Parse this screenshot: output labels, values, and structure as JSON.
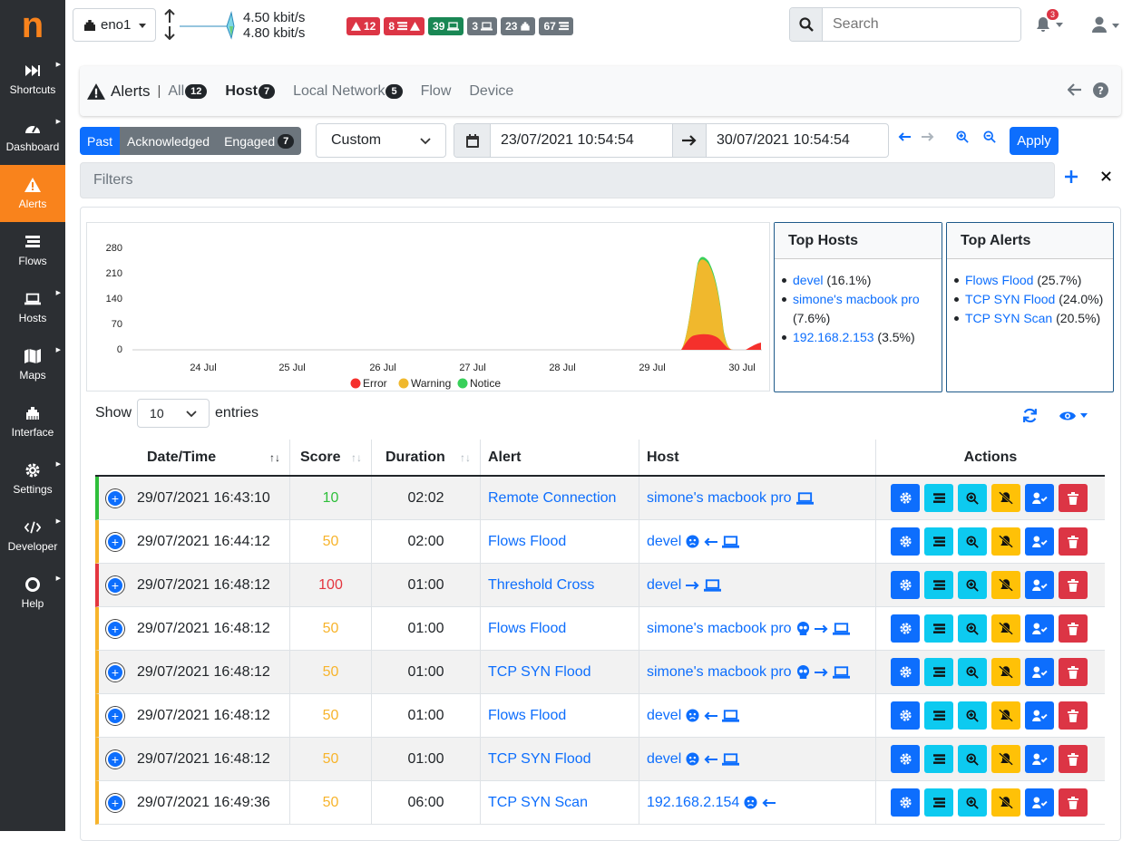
{
  "app": {
    "logo": "n"
  },
  "sidebar": {
    "items": [
      {
        "label": "Shortcuts",
        "icon": "fast-forward-icon"
      },
      {
        "label": "Dashboard",
        "icon": "gauge-icon"
      },
      {
        "label": "Alerts",
        "icon": "warning-icon",
        "active": true
      },
      {
        "label": "Flows",
        "icon": "stream-icon"
      },
      {
        "label": "Hosts",
        "icon": "laptop-icon"
      },
      {
        "label": "Maps",
        "icon": "map-icon"
      },
      {
        "label": "Interface",
        "icon": "ethernet-icon"
      },
      {
        "label": "Settings",
        "icon": "cog-icon"
      },
      {
        "label": "Developer",
        "icon": "code-icon"
      },
      {
        "label": "Help",
        "icon": "lifebuoy-icon"
      }
    ]
  },
  "topbar": {
    "interface": "eno1",
    "upload": "4.50 kbit/s",
    "download": "4.80 kbit/s",
    "search_placeholder": "Search",
    "notifications": "3",
    "badges": [
      {
        "value": "12",
        "color": "red"
      },
      {
        "value": "8",
        "color": "red"
      },
      {
        "value": "39",
        "color": "green"
      },
      {
        "value": "3",
        "color": "gray"
      },
      {
        "value": "23",
        "color": "gray"
      },
      {
        "value": "67",
        "color": "gray"
      }
    ]
  },
  "alerts_header": {
    "title": "Alerts",
    "tabs": [
      {
        "label": "All",
        "count": "12"
      },
      {
        "label": "Host",
        "count": "7",
        "active": true
      },
      {
        "label": "Local Network",
        "count": "5"
      },
      {
        "label": "Flow",
        "count": ""
      },
      {
        "label": "Device",
        "count": ""
      }
    ]
  },
  "toolbar": {
    "past": "Past",
    "acknowledged": "Acknowledged",
    "engaged": "Engaged",
    "engaged_count": "7",
    "range": "Custom",
    "date_from": "23/07/2021 10:54:54",
    "date_to": "30/07/2021 10:54:54",
    "apply": "Apply",
    "filters_placeholder": "Filters"
  },
  "chart_data": {
    "type": "area",
    "x_ticks": [
      "24 Jul",
      "25 Jul",
      "26 Jul",
      "27 Jul",
      "28 Jul",
      "29 Jul",
      "30 Jul"
    ],
    "y_ticks": [
      0,
      70,
      140,
      210,
      280
    ],
    "ylim": [
      0,
      280
    ],
    "series": [
      {
        "name": "Error",
        "color": "#f5302c"
      },
      {
        "name": "Warning",
        "color": "#f0b82d"
      },
      {
        "name": "Notice",
        "color": "#38d05a"
      }
    ]
  },
  "top_hosts": {
    "title": "Top Hosts",
    "items": [
      {
        "name": "devel",
        "pct": "(16.1%)"
      },
      {
        "name": "simone's macbook pro",
        "pct": "(7.6%)"
      },
      {
        "name": "192.168.2.153",
        "pct": "(3.5%)"
      }
    ]
  },
  "top_alerts": {
    "title": "Top Alerts",
    "items": [
      {
        "name": "Flows Flood",
        "pct": "(25.7%)"
      },
      {
        "name": "TCP SYN Flood",
        "pct": "(24.0%)"
      },
      {
        "name": "TCP SYN Scan",
        "pct": "(20.5%)"
      }
    ]
  },
  "table": {
    "show": "Show",
    "entries": "entries",
    "page_size": "10",
    "columns": [
      "Date/Time",
      "Score",
      "Duration",
      "Alert",
      "Host",
      "Actions"
    ],
    "rows": [
      {
        "date": "29/07/2021 16:43:10",
        "score": "10",
        "score_color": "#2fbf3b",
        "duration": "02:02",
        "alert": "Remote Connection",
        "host": "simone's macbook pro",
        "bar": "#2fbf3b"
      },
      {
        "date": "29/07/2021 16:44:12",
        "score": "50",
        "score_color": "#f7b42c",
        "duration": "02:00",
        "alert": "Flows Flood",
        "host": "devel",
        "bar": "#f7b42c"
      },
      {
        "date": "29/07/2021 16:48:12",
        "score": "100",
        "score_color": "#e4363f",
        "duration": "01:00",
        "alert": "Threshold Cross",
        "host": "devel",
        "bar": "#e4363f"
      },
      {
        "date": "29/07/2021 16:48:12",
        "score": "50",
        "score_color": "#f7b42c",
        "duration": "01:00",
        "alert": "Flows Flood",
        "host": "simone's macbook pro",
        "bar": "#f7b42c"
      },
      {
        "date": "29/07/2021 16:48:12",
        "score": "50",
        "score_color": "#f7b42c",
        "duration": "01:00",
        "alert": "TCP SYN Flood",
        "host": "simone's macbook pro",
        "bar": "#f7b42c"
      },
      {
        "date": "29/07/2021 16:48:12",
        "score": "50",
        "score_color": "#f7b42c",
        "duration": "01:00",
        "alert": "Flows Flood",
        "host": "devel",
        "bar": "#f7b42c"
      },
      {
        "date": "29/07/2021 16:48:12",
        "score": "50",
        "score_color": "#f7b42c",
        "duration": "01:00",
        "alert": "TCP SYN Flood",
        "host": "devel",
        "bar": "#f7b42c"
      },
      {
        "date": "29/07/2021 16:49:36",
        "score": "50",
        "score_color": "#f7b42c",
        "duration": "06:00",
        "alert": "TCP SYN Scan",
        "host": "192.168.2.154",
        "bar": "#f7b42c"
      }
    ]
  }
}
